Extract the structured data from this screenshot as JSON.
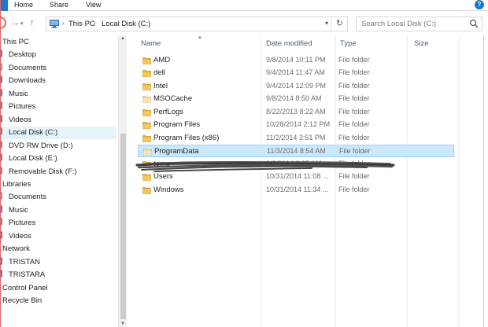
{
  "ribbon": {
    "tabs": [
      "Home",
      "Share",
      "View"
    ],
    "help_label": "?"
  },
  "toolbar": {
    "back_glyph": "‹",
    "forward_glyph": "→",
    "up_glyph": "↑",
    "dropdown_glyph": "▾",
    "refresh_glyph": "↻"
  },
  "address": {
    "segments": [
      "This PC",
      "Local Disk (C:)"
    ],
    "separator": "›"
  },
  "search": {
    "placeholder": "Search Local Disk (C:)"
  },
  "nav": {
    "items": [
      {
        "label": "This PC",
        "type": "root",
        "icon": "pc-icon",
        "color": ""
      },
      {
        "label": "Desktop",
        "type": "child",
        "icon": "desktop-icon",
        "color": "#3a87d6"
      },
      {
        "label": "Documents",
        "type": "child",
        "icon": "documents-icon",
        "color": "#8aa2c4"
      },
      {
        "label": "Downloads",
        "type": "child",
        "icon": "downloads-icon",
        "color": "#3a87d6"
      },
      {
        "label": "Music",
        "type": "child",
        "icon": "music-icon",
        "color": "#3a87d6"
      },
      {
        "label": "Pictures",
        "type": "child",
        "icon": "pictures-icon",
        "color": "#4ea06a"
      },
      {
        "label": "Videos",
        "type": "child",
        "icon": "videos-icon",
        "color": "#7a7a7a"
      },
      {
        "label": "Local Disk (C:)",
        "type": "child",
        "icon": "drive-icon",
        "color": "#8a8a8a",
        "selected": true
      },
      {
        "label": "DVD RW Drive (D:)",
        "type": "child",
        "icon": "dvd-icon",
        "color": "#8a8a8a"
      },
      {
        "label": "Local Disk (E:)",
        "type": "child",
        "icon": "drive-icon",
        "color": "#8a8a8a"
      },
      {
        "label": "Removable Disk (F:)",
        "type": "child",
        "icon": "removable-disk-icon",
        "color": "#8a8a8a"
      },
      {
        "label": "Libraries",
        "type": "root",
        "icon": "libraries-icon",
        "color": ""
      },
      {
        "label": "Documents",
        "type": "child",
        "icon": "documents-icon",
        "color": "#8aa2c4"
      },
      {
        "label": "Music",
        "type": "child",
        "icon": "music-icon",
        "color": "#3a87d6"
      },
      {
        "label": "Pictures",
        "type": "child",
        "icon": "pictures-icon",
        "color": "#4ea06a"
      },
      {
        "label": "Videos",
        "type": "child",
        "icon": "videos-icon",
        "color": "#7a7a7a"
      },
      {
        "label": "Network",
        "type": "root",
        "icon": "network-icon",
        "color": ""
      },
      {
        "label": "TRISTAN",
        "type": "child",
        "icon": "computer-icon",
        "color": "#3a87d6"
      },
      {
        "label": "TRISTARA",
        "type": "child",
        "icon": "computer-icon",
        "color": "#3a87d6"
      },
      {
        "label": "Control Panel",
        "type": "root",
        "icon": "control-panel-icon",
        "color": ""
      },
      {
        "label": "Recycle Bin",
        "type": "root",
        "icon": "recycle-bin-icon",
        "color": ""
      }
    ]
  },
  "columns": {
    "name": "Name",
    "date": "Date modified",
    "type": "Type",
    "size": "Size"
  },
  "files": [
    {
      "name": "AMD",
      "date": "9/8/2014 10:11 PM",
      "type": "File folder"
    },
    {
      "name": "dell",
      "date": "9/4/2014 11:47 AM",
      "type": "File folder"
    },
    {
      "name": "Intel",
      "date": "9/4/2014 12:09 PM",
      "type": "File folder"
    },
    {
      "name": "MSOCache",
      "date": "9/8/2014 8:50 AM",
      "type": "File folder",
      "hidden": true
    },
    {
      "name": "PerfLogs",
      "date": "8/22/2013 8:22 AM",
      "type": "File folder"
    },
    {
      "name": "Program Files",
      "date": "10/28/2014 2:12 PM",
      "type": "File folder"
    },
    {
      "name": "Program Files (x86)",
      "date": "11/2/2014 3:51 PM",
      "type": "File folder"
    },
    {
      "name": "ProgramData",
      "date": "11/3/2014 8:54 AM",
      "type": "File folder",
      "hidden": true,
      "selected": true
    },
    {
      "name": "temp",
      "date": "9/8/2014 9:35 AM",
      "type": "File folder"
    },
    {
      "name": "Users",
      "date": "10/31/2014 11:08 ...",
      "type": "File folder"
    },
    {
      "name": "Windows",
      "date": "10/31/2014 11:34 ...",
      "type": "File folder"
    }
  ],
  "colors": {
    "accent": "#1979ca",
    "selection": "#cce8ff",
    "folder": "#e8b84a",
    "scribble": "#3a3a3a"
  }
}
